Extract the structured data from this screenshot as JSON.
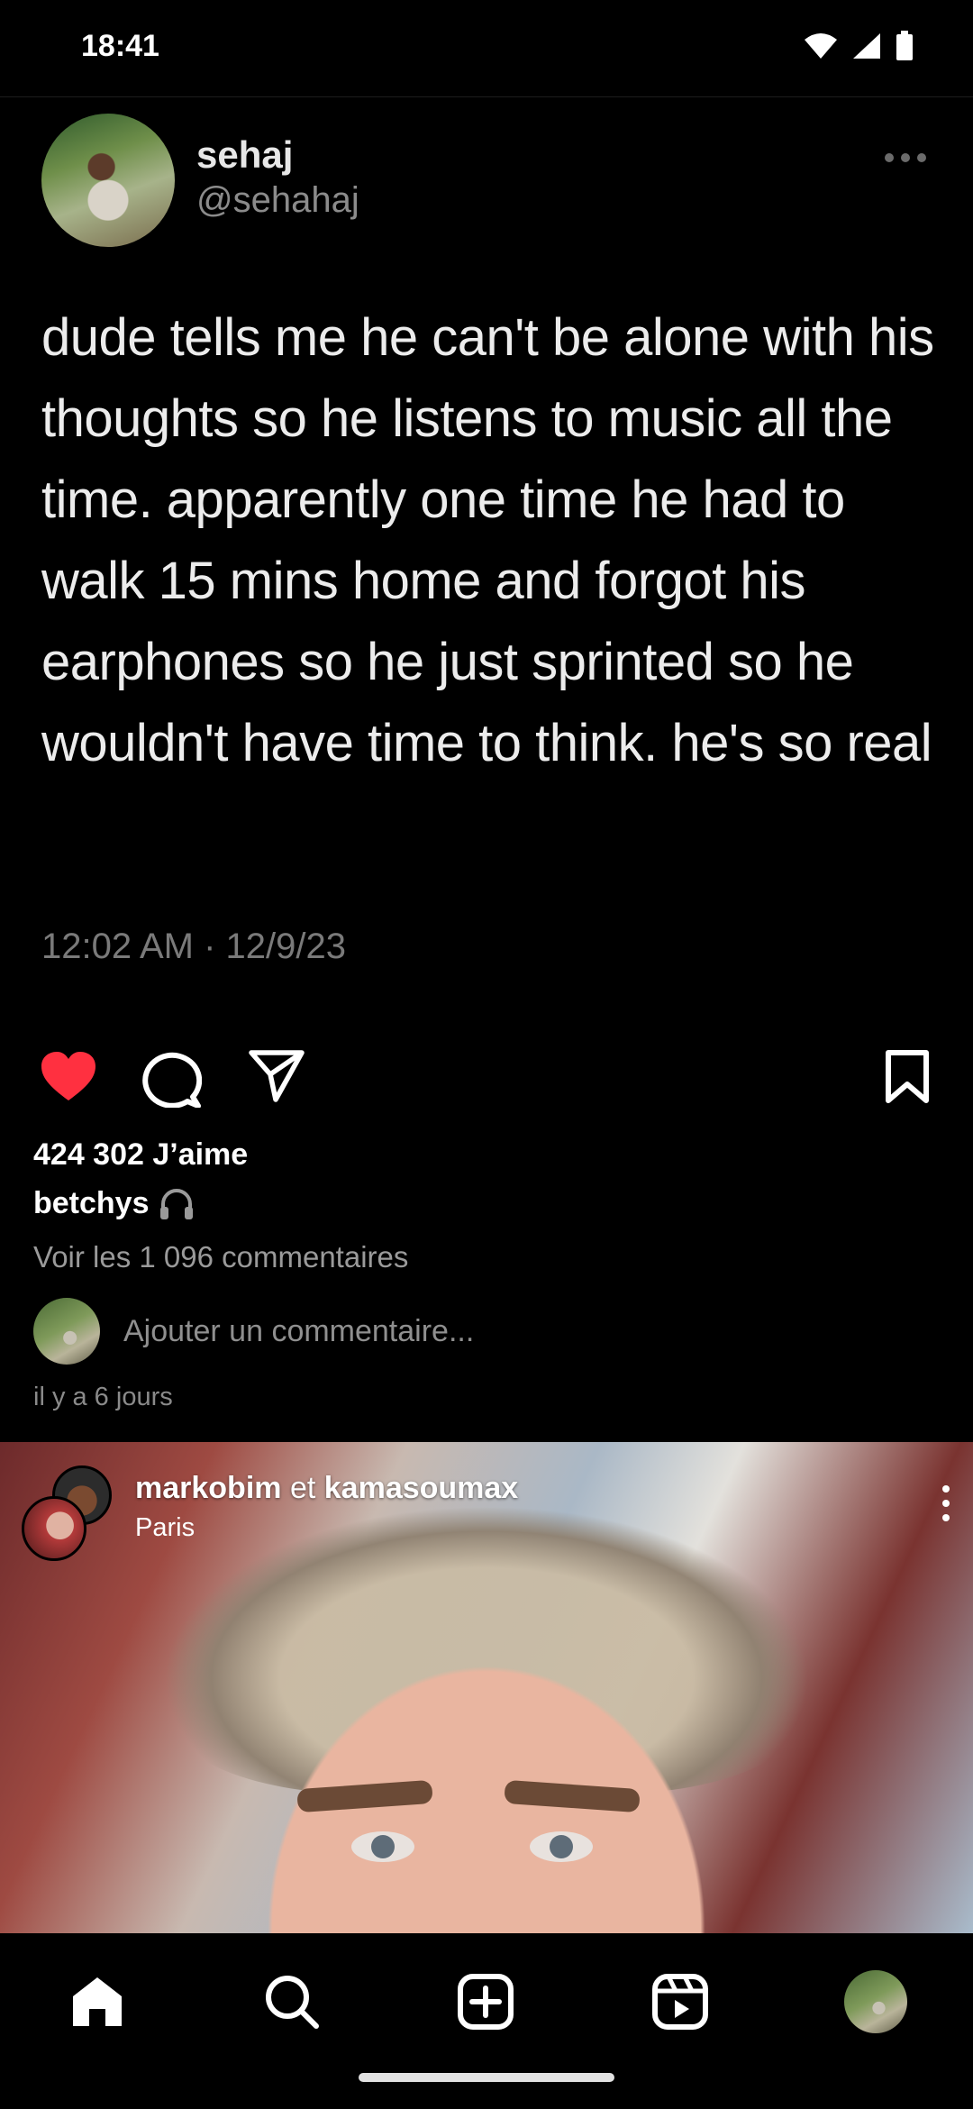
{
  "status_bar": {
    "time": "18:41",
    "icons": [
      "wifi-icon",
      "signal-icon",
      "battery-icon"
    ]
  },
  "tweet": {
    "name": "sehaj",
    "handle": "@sehahaj",
    "text": "dude tells me he can't be alone with his thoughts so he listens to music all the time. apparently one time he had to walk 15 mins home and forgot his earphones so he just sprinted so he wouldn't have time to think. he's so real",
    "timestamp": "12:02 AM · 12/9/23"
  },
  "post": {
    "likes": "424 302 J’aime",
    "caption_user": "betchys",
    "caption_icon": "headphones-icon",
    "view_comments": "Voir les 1 096 commentaires",
    "add_comment_placeholder": "Ajouter un commentaire...",
    "age": "il y a 6 jours",
    "liked": true,
    "like_color": "#ff3040"
  },
  "next_post": {
    "user1": "markobim",
    "joiner": "et",
    "user2": "kamasoumax",
    "location": "Paris"
  },
  "bottom_nav": [
    "home-icon",
    "search-icon",
    "create-icon",
    "reels-icon",
    "profile-avatar"
  ]
}
